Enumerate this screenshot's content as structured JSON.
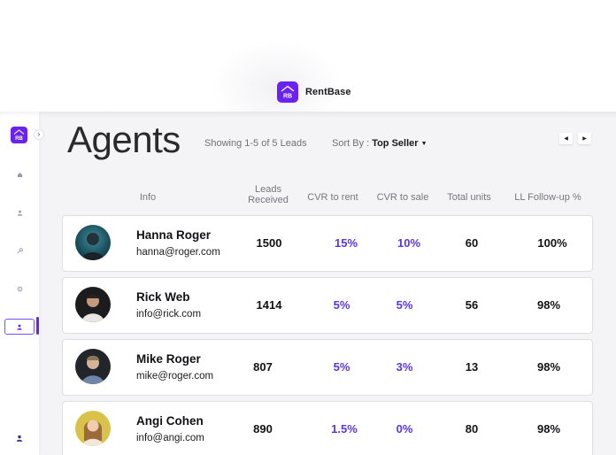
{
  "brand": {
    "name": "RentBase",
    "logo_text": "RB"
  },
  "page": {
    "title": "Agents",
    "showing": "Showing 1-5 of 5 Leads",
    "sort_label": "Sort By :",
    "sort_value": "Top Seller"
  },
  "sidebar": {
    "logo_text": "RB",
    "items": [
      {
        "icon": "home-icon"
      },
      {
        "icon": "user-icon"
      },
      {
        "icon": "key-icon"
      },
      {
        "icon": "settings-icon"
      },
      {
        "icon": "agents-icon",
        "active": true
      },
      {
        "icon": "profile-icon"
      }
    ]
  },
  "table": {
    "headers": [
      "Info",
      "Leads Received",
      "CVR to rent",
      "CVR to sale",
      "Total units",
      "LL Follow-up %"
    ],
    "headers_split": {
      "leads_line1": "Leads",
      "leads_line2": "Received"
    },
    "rows": [
      {
        "name": "Hanna Roger",
        "email": "hanna@roger.com",
        "leads": "1500",
        "cvr_rent": "15%",
        "cvr_sale": "10%",
        "units": "60",
        "followup": "100%"
      },
      {
        "name": "Rick Web",
        "email": "info@rick.com",
        "leads": "1414",
        "cvr_rent": "5%",
        "cvr_sale": "5%",
        "units": "56",
        "followup": "98%"
      },
      {
        "name": "Mike Roger",
        "email": "mike@roger.com",
        "leads": "807",
        "cvr_rent": "5%",
        "cvr_sale": "3%",
        "units": "13",
        "followup": "98%"
      },
      {
        "name": "Angi Cohen",
        "email": "info@angi.com",
        "leads": "890",
        "cvr_rent": "1.5%",
        "cvr_sale": "0%",
        "units": "80",
        "followup": "98%"
      }
    ]
  },
  "colors": {
    "accent": "#6b22f0",
    "metric": "#5b34e6"
  }
}
